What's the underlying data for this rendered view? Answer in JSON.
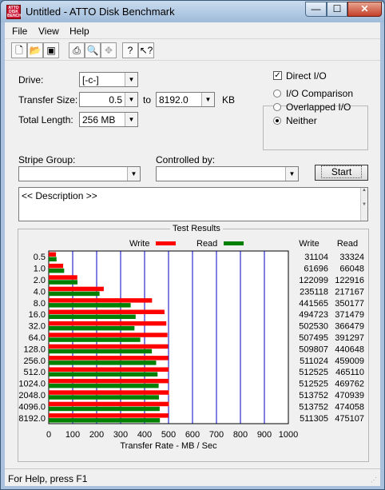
{
  "window": {
    "title": "Untitled - ATTO Disk Benchmark",
    "icon_text": "ATTO DISK BENCH"
  },
  "caption_buttons": {
    "minimize": "—",
    "maximize": "☐",
    "close": "✕"
  },
  "menu": {
    "file": "File",
    "view": "View",
    "help": "Help"
  },
  "toolbar": {
    "new": "new-file-icon",
    "open": "open-folder-icon",
    "save": "save-disk-icon",
    "print": "printer-icon",
    "preview": "print-preview-icon",
    "move": "move-arrows-icon",
    "help": "help-question-icon",
    "context_help": "context-help-icon"
  },
  "form": {
    "drive_label": "Drive:",
    "drive_value": "[-c-]",
    "transfer_label": "Transfer Size:",
    "transfer_from": "0.5",
    "to_label": "to",
    "transfer_to": "8192.0",
    "kb_label": "KB",
    "length_label": "Total Length:",
    "length_value": "256 MB",
    "direct_io_label": "Direct I/O",
    "direct_io_checked": true,
    "radio_io_comparison": "I/O Comparison",
    "radio_overlapped": "Overlapped I/O",
    "radio_neither": "Neither",
    "selected_mode": "Neither",
    "stripe_label": "Stripe Group:",
    "stripe_value": "",
    "controlled_label": "Controlled by:",
    "controlled_value": "",
    "start_label": "Start",
    "description": "<< Description >>"
  },
  "status": {
    "text": "For Help, press F1"
  },
  "chart_data": {
    "type": "bar",
    "title": "Test Results",
    "xlabel": "Transfer Rate - MB / Sec",
    "xlim": [
      0,
      1000
    ],
    "xticks": [
      "0",
      "100",
      "200",
      "300",
      "400",
      "500",
      "600",
      "700",
      "800",
      "900",
      "1000"
    ],
    "categories": [
      "0.5",
      "1.0",
      "2.0",
      "4.0",
      "8.0",
      "16.0",
      "32.0",
      "64.0",
      "128.0",
      "256.0",
      "512.0",
      "1024.0",
      "2048.0",
      "4096.0",
      "8192.0"
    ],
    "series": [
      {
        "name": "Write",
        "color": "#ff0000",
        "values_kb": [
          31104,
          61696,
          122099,
          235118,
          441565,
          494723,
          502530,
          507495,
          509807,
          511024,
          512525,
          512525,
          513752,
          513752,
          511305
        ]
      },
      {
        "name": "Read",
        "color": "#008000",
        "values_kb": [
          33324,
          66048,
          122916,
          217167,
          350177,
          371479,
          366479,
          391297,
          440648,
          459009,
          465110,
          469762,
          470939,
          474058,
          475107
        ]
      }
    ],
    "column_headers": {
      "write": "Write",
      "read": "Read"
    },
    "legend": "top"
  }
}
